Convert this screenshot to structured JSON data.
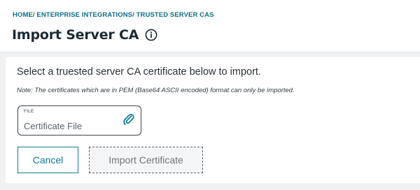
{
  "breadcrumb": {
    "items": [
      "HOME",
      "ENTERPRISE INTEGRATIONS",
      "TRUSTED SERVER CAS"
    ],
    "separator": "/ "
  },
  "page": {
    "title": "Import Server CA",
    "info_icon": "info-circle-icon"
  },
  "form": {
    "intro": "Select a truested server CA certificate below to import.",
    "note": "Note: The certificates which are in PEM (Base64 ASCII encoded) format can only be imported.",
    "file_field": {
      "label": "FILE",
      "placeholder": "Certificate File",
      "icon": "paperclip-icon"
    },
    "buttons": {
      "cancel": "Cancel",
      "import": "Import Certificate"
    }
  },
  "colors": {
    "accent": "#0e7c99",
    "breadcrumb": "#0e6e86",
    "background": "#f0f1f3"
  }
}
